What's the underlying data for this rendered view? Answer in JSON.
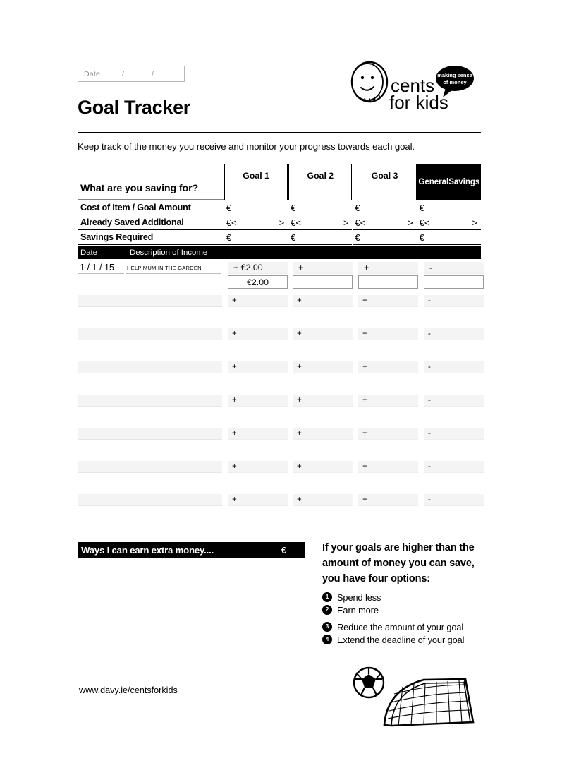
{
  "header": {
    "date_field": {
      "label": "Date",
      "slash1": "/",
      "slash2": "/"
    },
    "title": "Goal Tracker",
    "subtitle": "Keep track of the money you receive and monitor your progress towards each goal.",
    "logo": {
      "name_line1": "cents",
      "name_line2": "for kids",
      "bubble_line1": "making sense",
      "bubble_line2": "of money"
    }
  },
  "goals_table": {
    "question_label": "What are you saving for?",
    "columns": [
      "Goal 1",
      "Goal 2",
      "Goal 3",
      "General Savings"
    ],
    "general_savings_line1": "General",
    "general_savings_line2": "Savings",
    "rows": [
      {
        "label": "Cost of Item / Goal Amount",
        "cells": [
          "€",
          "€",
          "€",
          "€"
        ],
        "has_arrows": false
      },
      {
        "label": "Already Saved Additional",
        "cells": [
          "€<",
          "€<",
          "€<",
          "€<"
        ],
        "arrow": ">",
        "has_arrows": true
      },
      {
        "label": "Savings Required",
        "cells": [
          "€",
          "€",
          "€",
          "€"
        ],
        "has_arrows": false
      }
    ]
  },
  "income_table": {
    "header": {
      "date": "Date",
      "description": "Description of Income"
    },
    "rows": [
      {
        "date": "1 / 1 / 15",
        "description": "HELP MUM IN THE GARDEN",
        "filled": true,
        "cells": [
          "+ €2.00",
          "+",
          "+",
          "-"
        ],
        "totals": [
          "€2.00",
          "",
          "",
          ""
        ]
      },
      {
        "date": "",
        "description": "",
        "filled": false,
        "cells": [
          "+",
          "+",
          "+",
          "-"
        ],
        "totals": [
          "",
          "",
          "",
          ""
        ]
      },
      {
        "date": "",
        "description": "",
        "filled": false,
        "cells": [
          "+",
          "+",
          "+",
          "-"
        ],
        "totals": [
          "",
          "",
          "",
          ""
        ]
      },
      {
        "date": "",
        "description": "",
        "filled": false,
        "cells": [
          "+",
          "+",
          "+",
          "-"
        ],
        "totals": [
          "",
          "",
          "",
          ""
        ]
      },
      {
        "date": "",
        "description": "",
        "filled": false,
        "cells": [
          "+",
          "+",
          "+",
          "-"
        ],
        "totals": [
          "",
          "",
          "",
          ""
        ]
      },
      {
        "date": "",
        "description": "",
        "filled": false,
        "cells": [
          "+",
          "+",
          "+",
          "-"
        ],
        "totals": [
          "",
          "",
          "",
          ""
        ]
      },
      {
        "date": "",
        "description": "",
        "filled": false,
        "cells": [
          "+",
          "+",
          "+",
          "-"
        ],
        "totals": [
          "",
          "",
          "",
          ""
        ]
      },
      {
        "date": "",
        "description": "",
        "filled": false,
        "cells": [
          "+",
          "+",
          "+",
          "-"
        ],
        "totals": [
          "",
          "",
          "",
          ""
        ]
      }
    ]
  },
  "ways_section": {
    "title": "Ways I can earn extra money....",
    "currency": "€"
  },
  "options_section": {
    "title": "If your goals are higher than the amount of money you can save, you have four options:",
    "items": [
      {
        "num": "1",
        "text": "Spend less"
      },
      {
        "num": "2",
        "text": "Earn more"
      },
      {
        "num": "3",
        "text": "Reduce the amount of your goal"
      },
      {
        "num": "4",
        "text": "Extend the deadline of your goal"
      }
    ]
  },
  "footer": {
    "url": "www.davy.ie/centsforkids"
  },
  "colors": {
    "ink": "#000000",
    "row_fill": "#f4f4f4",
    "muted": "#8a8a8a"
  }
}
